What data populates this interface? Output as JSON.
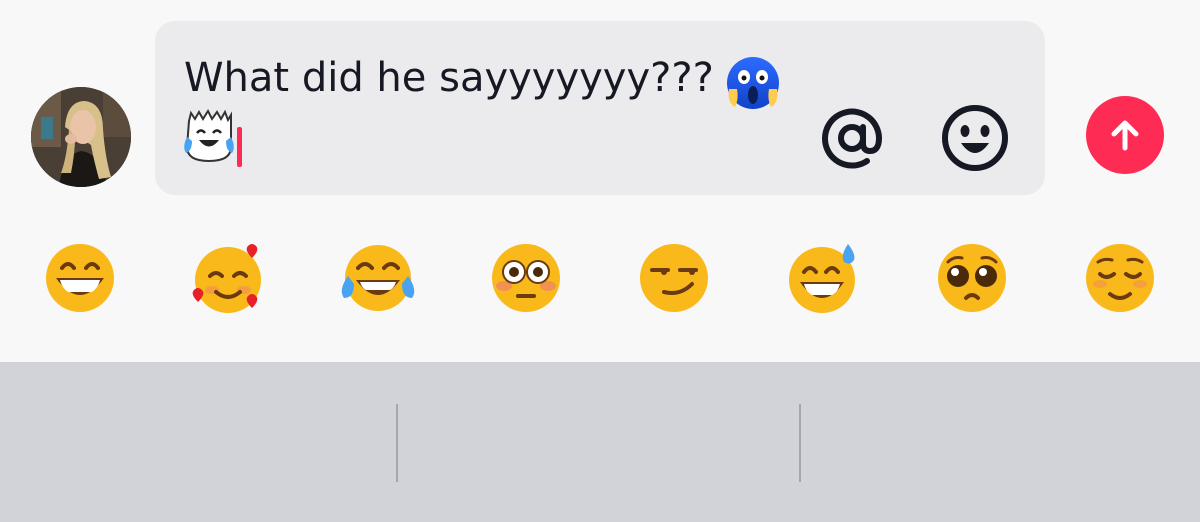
{
  "composer": {
    "text": "What did he sayyyyyyy???",
    "avatar_icon": "user-avatar-photo",
    "inline_emojis": [
      "face-screaming-in-fear",
      "crying-laughing-ghost-sticker"
    ]
  },
  "toolbar": {
    "mention_icon": "at-sign-icon",
    "emoji_icon": "smiley-icon",
    "send_icon": "arrow-up-icon"
  },
  "quick_emojis": [
    "grinning-face-with-smiling-eyes",
    "smiling-face-with-hearts",
    "face-with-tears-of-joy",
    "flushed-face",
    "smirking-face",
    "grinning-face-with-sweat",
    "pleading-face",
    "relieved-face"
  ],
  "colors": {
    "accent": "#fe2c55",
    "bubble": "#ebebed",
    "text": "#161823",
    "keyboard": "#d1d3d9",
    "emoji_yellow": "#f9b91a"
  }
}
